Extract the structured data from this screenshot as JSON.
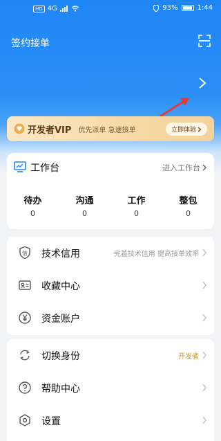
{
  "status_bar": {
    "network": "HD",
    "signal": "4G",
    "battery_percent": "93%",
    "time": "1:44"
  },
  "header": {
    "title": "签约接单"
  },
  "vip_banner": {
    "title": "开发者VIP",
    "subtitle": "优先派单 急速接单",
    "button_label": "立即体验"
  },
  "workbench": {
    "title": "工作台",
    "enter_label": "进入工作台",
    "stats": [
      {
        "label": "待办",
        "value": "0"
      },
      {
        "label": "沟通",
        "value": "0"
      },
      {
        "label": "工作",
        "value": "0"
      },
      {
        "label": "整包",
        "value": "0"
      }
    ]
  },
  "menu_group1": [
    {
      "label": "技术信用",
      "extra": "完善技术信用 提高接单效率",
      "icon": "shield-icon"
    },
    {
      "label": "收藏中心",
      "extra": "",
      "icon": "id-card-icon"
    },
    {
      "label": "资金账户",
      "extra": "",
      "icon": "yen-icon"
    }
  ],
  "menu_group2": [
    {
      "label": "切换身份",
      "extra": "开发者",
      "icon": "switch-icon"
    },
    {
      "label": "帮助中心",
      "extra": "",
      "icon": "help-icon"
    },
    {
      "label": "设置",
      "extra": "",
      "icon": "settings-icon"
    }
  ],
  "colors": {
    "primary_blue": "#1f86f5",
    "vip_gold": "#f6d9a6",
    "identity_orange": "#c8963c",
    "annotation_red": "#e23b3b"
  }
}
